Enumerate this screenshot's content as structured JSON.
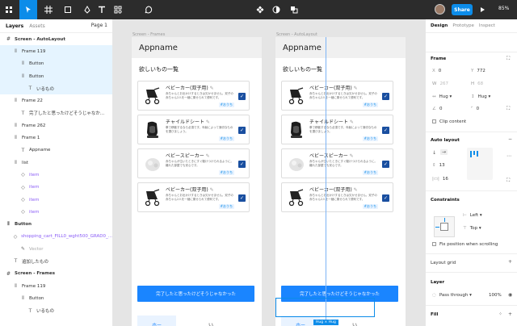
{
  "toolbar": {
    "zoom": "85%",
    "share_label": "Share"
  },
  "left_panel": {
    "tabs": [
      "Layers",
      "Assets"
    ],
    "page_label": "Page 1",
    "layers": [
      {
        "label": "Screen - AutoLayout",
        "icon": "frame-icon",
        "indent": 0,
        "bold": true,
        "selected": false
      },
      {
        "label": "Frame 119",
        "icon": "autolayout-icon",
        "indent": 1,
        "bold": false,
        "selected": true
      },
      {
        "label": "Button",
        "icon": "autolayout-icon",
        "indent": 2,
        "bold": false,
        "selected": true
      },
      {
        "label": "Button",
        "icon": "autolayout-icon",
        "indent": 2,
        "bold": false,
        "selected": true
      },
      {
        "label": "いるもの",
        "icon": "text-icon",
        "indent": 3,
        "bold": false,
        "selected": true
      },
      {
        "label": "Frame 22",
        "icon": "autolayout-icon",
        "indent": 1,
        "bold": false,
        "selected": false
      },
      {
        "label": "完了したと思ったけどそうじゃなか...",
        "icon": "text-icon",
        "indent": 2,
        "bold": false,
        "selected": false
      },
      {
        "label": "Frame 262",
        "icon": "autolayout-icon",
        "indent": 1,
        "bold": false,
        "selected": false
      },
      {
        "label": "Frame 1",
        "icon": "autolayout-icon",
        "indent": 1,
        "bold": false,
        "selected": false
      },
      {
        "label": "Appname",
        "icon": "text-icon",
        "indent": 2,
        "bold": false,
        "selected": false
      },
      {
        "label": "list",
        "icon": "autolayout-icon",
        "indent": 1,
        "bold": false,
        "selected": false
      },
      {
        "label": "item",
        "icon": "component-icon",
        "indent": 2,
        "bold": false,
        "selected": false,
        "purple": true
      },
      {
        "label": "item",
        "icon": "component-icon",
        "indent": 2,
        "bold": false,
        "selected": false,
        "purple": true
      },
      {
        "label": "item",
        "icon": "component-icon",
        "indent": 2,
        "bold": false,
        "selected": false,
        "purple": true
      },
      {
        "label": "item",
        "icon": "component-icon",
        "indent": 2,
        "bold": false,
        "selected": false,
        "purple": true
      },
      {
        "label": "Button",
        "icon": "autolayout-icon",
        "indent": 0,
        "bold": true,
        "selected": false
      },
      {
        "label": "shopping_cart_FILL0_wght500_GRAD0_...",
        "icon": "component-icon",
        "indent": 1,
        "bold": false,
        "selected": false,
        "purple": true
      },
      {
        "label": "Vector",
        "icon": "vector-icon",
        "indent": 2,
        "bold": false,
        "selected": false,
        "muted": true
      },
      {
        "label": "追加したもの",
        "icon": "text-icon",
        "indent": 1,
        "bold": false,
        "selected": false
      },
      {
        "label": "Screen - Frames",
        "icon": "frame-icon",
        "indent": 0,
        "bold": true,
        "selected": false
      },
      {
        "label": "Frame 119",
        "icon": "autolayout-icon",
        "indent": 1,
        "bold": false,
        "selected": false
      },
      {
        "label": "Button",
        "icon": "autolayout-icon",
        "indent": 2,
        "bold": false,
        "selected": false
      },
      {
        "label": "いるもの",
        "icon": "text-icon",
        "indent": 3,
        "bold": false,
        "selected": false
      }
    ]
  },
  "canvas": {
    "frames": [
      {
        "label": "Screen - Frames"
      },
      {
        "label": "Screen - AutoLayout"
      }
    ],
    "app_name": "Appname",
    "list_title": "欲しいもの一覧",
    "items": [
      {
        "name": "ベビーカー(双子用)",
        "desc": "赤ちゃんとお出かけするときは欠かせません。双子の赤ちゃん2人を一緒に乗せられて便利です。",
        "tag": "#おうち",
        "image": "stroller"
      },
      {
        "name": "チャイルドシート",
        "desc": "車で移動するなら必須です。年齢によって適切なものを選びましょう。",
        "tag": "#おうち",
        "image": "carseat"
      },
      {
        "name": "ベビースピーカー",
        "desc": "赤ちゃんが泣いたときにすぐ駆けつけられるように。離れた部屋でも安心です。",
        "tag": "#おうち",
        "image": "speaker"
      },
      {
        "name": "ベビーカー(双子用)",
        "desc": "赤ちゃんとお出かけするときは欠かせません。双子の赤ちゃん2人を一緒に乗せられて便利です。",
        "tag": "#おうち",
        "image": "stroller"
      }
    ],
    "done_label": "完了したと思ったけどそうじゃなかった",
    "tab_home": "ホー",
    "tab_other": "い",
    "hug_label": "Hug × Hug"
  },
  "right_panel": {
    "tabs": [
      "Design",
      "Prototype",
      "Inspect"
    ],
    "frame_heading": "Frame",
    "x": "0",
    "y": "772",
    "w": "267",
    "h": "68",
    "w_mode": "Hug",
    "h_mode": "Hug",
    "rotation": "0",
    "corner": "0",
    "clip_label": "Clip content",
    "autolayout_heading": "Auto layout",
    "gap": "13",
    "padding_h": "16",
    "padding_v": "8",
    "constraints_heading": "Constraints",
    "constraint_h": "Left",
    "constraint_v": "Top",
    "fix_position_label": "Fix position when scrolling",
    "layout_grid_heading": "Layout grid",
    "layer_heading": "Layer",
    "blend_mode": "Pass through",
    "opacity": "100%",
    "fill_heading": "Fill"
  }
}
